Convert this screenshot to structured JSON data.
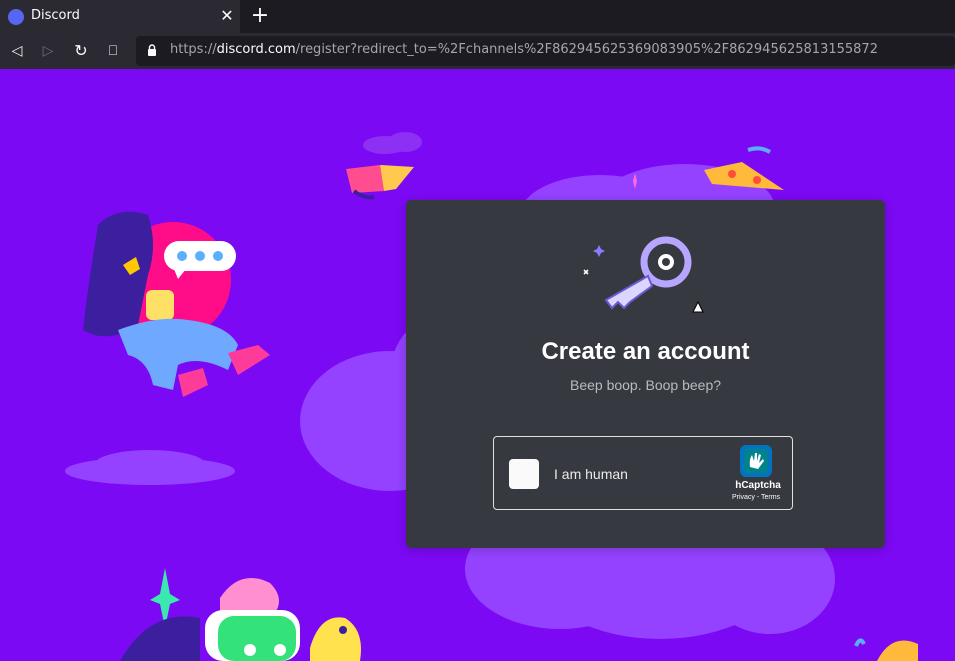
{
  "browser": {
    "tab_title": "Discord",
    "tab_close": "✕",
    "new_tab": "+",
    "back": "◁",
    "forward": "▷",
    "reload": "↻",
    "bookmark": "⎕",
    "url_prefix": "https://",
    "url_host": "discord.com",
    "url_path": "/register?redirect_to=%2Fchannels%2F862945625369083905%2F862945625813155872"
  },
  "modal": {
    "title": "Create an account",
    "subtitle": "Beep boop. Boop beep?"
  },
  "captcha": {
    "label": "I am human",
    "brand": "hCaptcha",
    "links": "Privacy - Terms"
  },
  "colors": {
    "background": "#7c09f3",
    "modal": "#36393f",
    "accent": "#5865f2"
  }
}
